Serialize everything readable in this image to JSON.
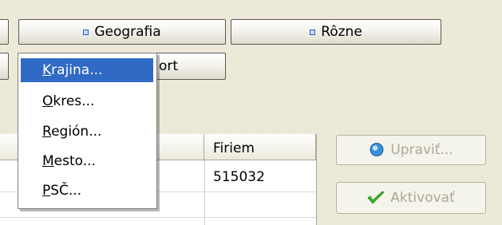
{
  "tabs_row1": [
    {
      "label": "Geografia"
    },
    {
      "label": "Rôzne"
    }
  ],
  "tabs_row2": [
    {
      "label": "ort"
    }
  ],
  "grid": {
    "columns": [
      {
        "label": "Firiem"
      }
    ],
    "rows": [
      {
        "firiem": "515032"
      },
      {
        "firiem": ""
      }
    ]
  },
  "actions": {
    "edit_label": "Upraviť...",
    "activate_label": "Aktivovať"
  },
  "menu": {
    "items": [
      {
        "mnemonic": "K",
        "rest": "rajina...",
        "highlighted": true
      },
      {
        "mnemonic": "O",
        "rest": "kres...",
        "highlighted": false
      },
      {
        "mnemonic": "R",
        "rest": "egión...",
        "highlighted": false
      },
      {
        "mnemonic": "M",
        "rest": "esto...",
        "highlighted": false
      },
      {
        "mnemonic": "P",
        "rest": "SČ...",
        "highlighted": false
      }
    ]
  },
  "colors": {
    "window_bg": "#ece9d8",
    "menu_highlight": "#316ac5",
    "disabled_text": "#aca899",
    "check_green": "#3fb52a"
  },
  "icons": {
    "tab_bullet": "bullet-icon",
    "edit": "edit-bubble-icon",
    "activate": "checkmark-icon"
  }
}
